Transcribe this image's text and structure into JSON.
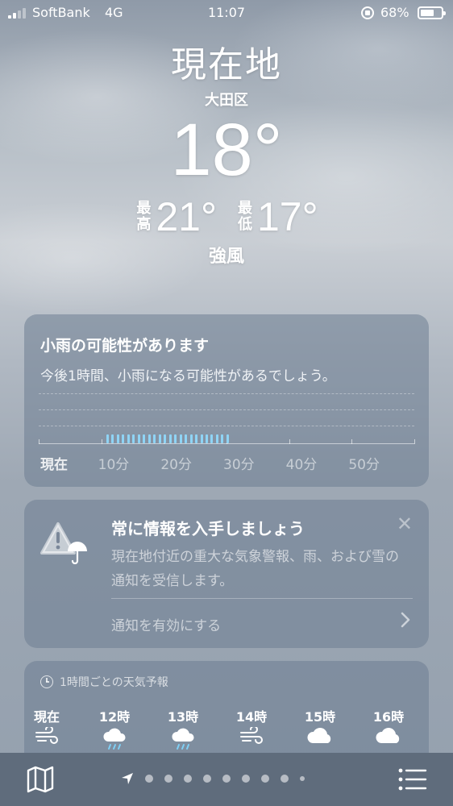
{
  "status_bar": {
    "carrier": "SoftBank",
    "network": "4G",
    "time": "11:07",
    "battery_percent": "68%",
    "battery_level": 0.68,
    "signal_bars": 2
  },
  "header": {
    "location": "現在地",
    "district": "大田区",
    "temperature": "18°",
    "high_tag": "最高",
    "high": "21°",
    "low_tag": "最低",
    "low": "17°",
    "condition": "強風"
  },
  "rain_card": {
    "title": "小雨の可能性があります",
    "description": "今後1時間、小雨になる可能性があるでしょう。",
    "labels": [
      "現在",
      "10分",
      "20分",
      "30分",
      "40分",
      "50分"
    ],
    "rain_start_minute": 10,
    "rain_end_minute": 30,
    "bar_color": "#8fd4f5"
  },
  "notify_card": {
    "icon": "warning-umbrella-icon",
    "title": "常に情報を入手しましょう",
    "description": "現在地付近の重大な気象警報、雨、および雪の通知を受信します。",
    "action": "通知を有効にする"
  },
  "hourly_card": {
    "header": "1時間ごとの天気予報",
    "hours": [
      {
        "label": "現在",
        "icon": "wind-icon"
      },
      {
        "label": "12時",
        "icon": "cloud-rain-icon"
      },
      {
        "label": "13時",
        "icon": "cloud-rain-icon"
      },
      {
        "label": "14時",
        "icon": "wind-icon"
      },
      {
        "label": "15時",
        "icon": "cloud-icon"
      },
      {
        "label": "16時",
        "icon": "cloud-icon"
      }
    ]
  },
  "bottom_bar": {
    "map_icon": "map-icon",
    "list_icon": "list-icon",
    "page_dots": 9
  }
}
